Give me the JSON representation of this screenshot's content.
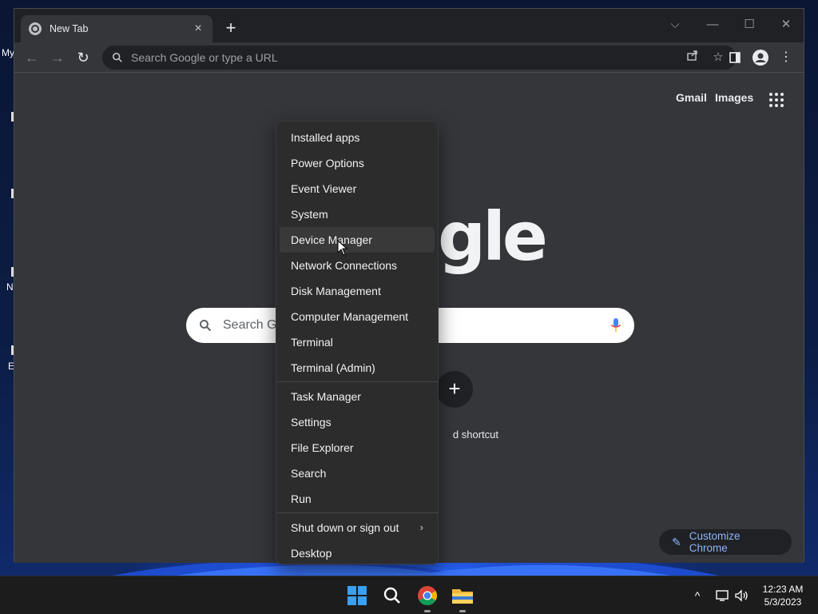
{
  "desktop": {
    "icon_labels": [
      "My",
      "N",
      "E"
    ]
  },
  "browser": {
    "tab": {
      "title": "New Tab",
      "close": "×"
    },
    "new_tab": "+",
    "window_controls": {
      "dropdown": "⌵",
      "minimize": "—",
      "maximize": "☐",
      "close": "✕"
    },
    "nav": {
      "back": "←",
      "forward": "→",
      "reload": "↻"
    },
    "omnibox": {
      "placeholder": "Search Google or type a URL",
      "value": ""
    }
  },
  "ntp": {
    "gmail": "Gmail",
    "images": "Images",
    "logo_visible_text": "gle",
    "search_placeholder": "Search Google or type a URL",
    "shortcut_add": "+",
    "shortcut_label": "Add shortcut",
    "shortcut_label_visible": "d shortcut",
    "customize_label": "Customize Chrome",
    "search_visible_text": "Search G"
  },
  "context_menu": {
    "group1": [
      "Installed apps",
      "Power Options",
      "Event Viewer",
      "System",
      "Device Manager",
      "Network Connections",
      "Disk Management",
      "Computer Management",
      "Terminal",
      "Terminal (Admin)"
    ],
    "group2": [
      "Task Manager",
      "Settings",
      "File Explorer",
      "Search",
      "Run"
    ],
    "group3": [
      {
        "label": "Shut down or sign out",
        "submenu": "›"
      },
      {
        "label": "Desktop"
      }
    ],
    "hovered": "Device Manager"
  },
  "taskbar": {
    "tray_chevron": "^",
    "clock": {
      "time": "12:23 AM",
      "date": "5/3/2023"
    }
  },
  "colors": {
    "accent_link": "#8ab4f8",
    "menu_bg": "#2c2c2c",
    "ntp_bg": "#35363a",
    "titlebar_bg": "#202124"
  }
}
